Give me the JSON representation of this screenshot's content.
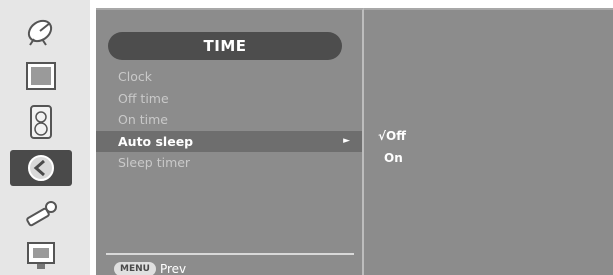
{
  "left_icons": [
    {
      "name": "satellite-dish-icon",
      "active": false
    },
    {
      "name": "picture-icon",
      "active": false
    },
    {
      "name": "audio-icon",
      "active": false
    },
    {
      "name": "time-clock-icon",
      "active": true
    },
    {
      "name": "wrench-icon",
      "active": false
    },
    {
      "name": "screen-icon",
      "active": false
    }
  ],
  "menu": {
    "title": "TIME",
    "items": [
      {
        "label": "Clock"
      },
      {
        "label": "Off time"
      },
      {
        "label": "On time"
      },
      {
        "label": "Auto sleep",
        "selected": true,
        "arrow": "►"
      },
      {
        "label": "Sleep timer"
      }
    ],
    "footer": {
      "badge": "MENU",
      "label": "Prev"
    }
  },
  "submenu": {
    "items": [
      {
        "label": "√Off",
        "selected": true
      },
      {
        "label": "On"
      }
    ]
  },
  "colors": {
    "panel": "#8c8c8c",
    "selected_row": "#6e6e6e",
    "title_bar": "#4d4d4d",
    "icon_column": "#e6e6e6",
    "active_icon": "#4a4a4a"
  }
}
